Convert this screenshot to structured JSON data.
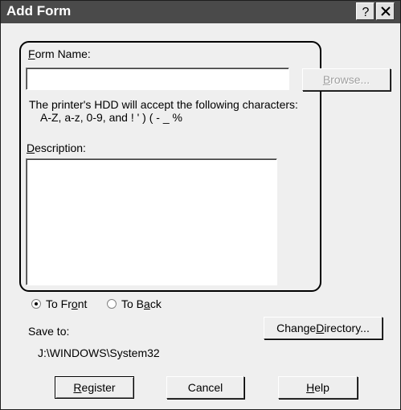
{
  "window": {
    "title": "Add Form",
    "help_glyph": "?",
    "close_glyph": "×"
  },
  "form_name": {
    "label_underlined": "F",
    "label_rest": "orm Name:",
    "value": ""
  },
  "browse_button": {
    "label_underlined": "B",
    "label_rest": "rowse..."
  },
  "info": {
    "line1": "The printer's HDD will accept the following characters:",
    "line2": "A-Z, a-z, 0-9, and ! ' ) ( - _ %"
  },
  "description": {
    "label_underlined": "D",
    "label_rest": "escription:",
    "value": ""
  },
  "placement": {
    "front": {
      "label_prefix": "To Fr",
      "label_underlined": "o",
      "label_rest": "nt",
      "selected": true
    },
    "back": {
      "label_prefix": "To B",
      "label_underlined": "a",
      "label_rest": "ck",
      "selected": false
    }
  },
  "save": {
    "label": "Save to:",
    "path": "J:\\WINDOWS\\System32"
  },
  "change_directory_button": {
    "label_prefix": "Change ",
    "label_underlined": "D",
    "label_rest": "irectory..."
  },
  "buttons": {
    "register": {
      "label_underlined": "R",
      "label_rest": "egister"
    },
    "cancel": {
      "label": "Cancel"
    },
    "help": {
      "label_underlined": "H",
      "label_rest": "elp"
    }
  }
}
